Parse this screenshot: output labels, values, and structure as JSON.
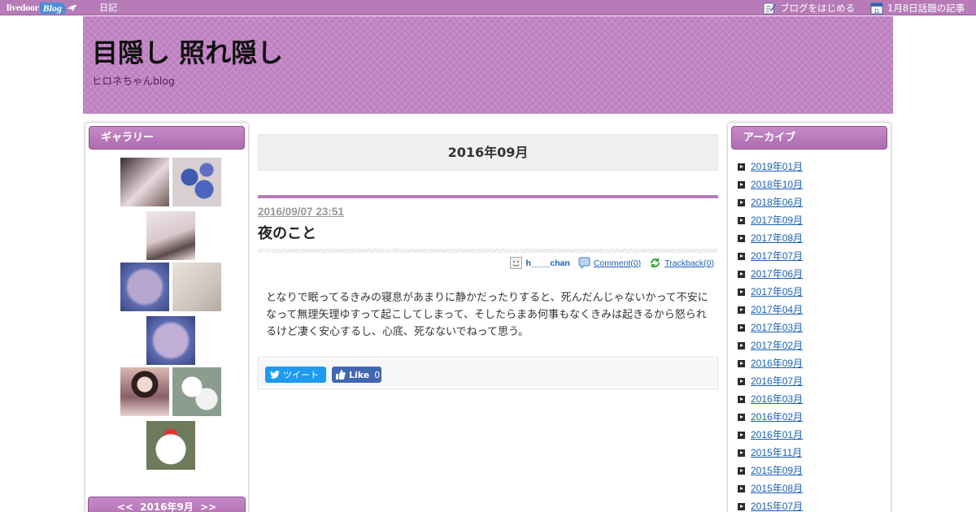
{
  "topbar": {
    "logo_text": "livedoor",
    "logo_blog": "Blog",
    "diary_link": "日記",
    "start_blog": "ブログをはじめる",
    "topic_articles": "1月8日話題の記事",
    "calendar_day": "11"
  },
  "header": {
    "title": "目隠し 照れ隠し",
    "subtitle": "ヒロネちゃんblog"
  },
  "gallery": {
    "heading": "ギャラリー",
    "thumb_count": 10
  },
  "calendar": {
    "prev": "<<",
    "label": "2016年9月",
    "next": ">>"
  },
  "main": {
    "month_heading": "2016年09月",
    "entry": {
      "date": "2016/09/07 23:51",
      "title": "夜のこと",
      "author": "h____chan",
      "comment": "Comment(0)",
      "trackback": "Trackback(0)",
      "body": "となりで眠ってるきみの寝息があまりに静かだったりすると、死んだんじゃないかって不安になって無理矢理ゆすって起こしてしまって、そしたらまあ何事もなくきみは起きるから怒られるけど凄く安心するし、心底、死なないでねって思う。"
    },
    "share": {
      "tweet": "ツイート",
      "like": "Like",
      "like_count": "0"
    }
  },
  "archive": {
    "heading": "アーカイブ",
    "items": [
      "2019年01月",
      "2018年10月",
      "2018年06月",
      "2017年09月",
      "2017年08月",
      "2017年07月",
      "2017年06月",
      "2017年05月",
      "2017年04月",
      "2017年03月",
      "2017年02月",
      "2016年09月",
      "2016年07月",
      "2016年03月",
      "2016年02月",
      "2016年01月",
      "2015年11月",
      "2015年09月",
      "2015年08月",
      "2015年07月"
    ]
  },
  "colors": {
    "accent": "#b77cb8",
    "link": "#1a5fb4"
  }
}
